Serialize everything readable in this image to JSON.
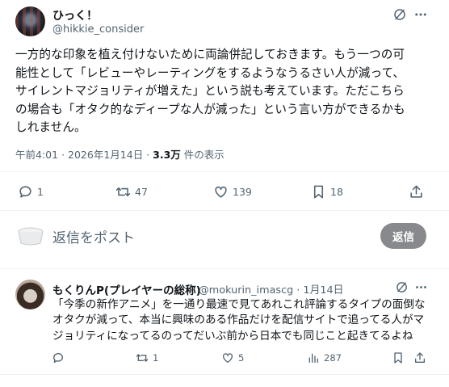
{
  "post": {
    "display_name": "ひっく！",
    "handle": "@hikkie_consider",
    "text_lines": [
      "一方的な印象を植え付けないために両論併記しておきます。もう一つの可",
      "能性として「レビューやレーティングをするようなうるさい人が減って、",
      "サイレントマジョリティが増えた」という説も考えています。ただこちら",
      "の場合も「オタク的なディープな人が減った」という言い方ができるかも",
      "しれません。"
    ],
    "time": "午前4:01",
    "date": "2026年1月14日",
    "views_count": "3.3万",
    "views_label": "件の表示",
    "separator": "·",
    "actions": {
      "reply_count": "1",
      "repost_count": "47",
      "like_count": "139",
      "bookmark_count": "18"
    }
  },
  "reply_composer": {
    "placeholder": "返信をポスト",
    "button_label": "返信"
  },
  "reply": {
    "display_name": "もくりんP(プレイヤーの総称)",
    "handle_date": "@mokurin_imascg · 1月14日",
    "text_lines": [
      "「今季の新作アニメ」を一通り最速で見てあれこれ評論するタイプの面倒な",
      "オタクが減って、本当に興味のある作品だけを配信サイトで追ってる人がマ",
      "ジョリティになってるのってだいぶ前から日本でも同じこと起きてるよね"
    ],
    "actions": {
      "reply_count": "",
      "repost_count": "1",
      "like_count": "5",
      "views_count": "287"
    }
  },
  "colors": {
    "text_primary": "#0f1419",
    "text_secondary": "#536471",
    "divider": "#eff3f4",
    "reply_button_bg": "#87898c"
  },
  "icons": [
    "grok-icon",
    "more-icon",
    "reply-icon",
    "repost-icon",
    "like-icon",
    "bookmark-icon",
    "share-icon",
    "views-icon"
  ]
}
